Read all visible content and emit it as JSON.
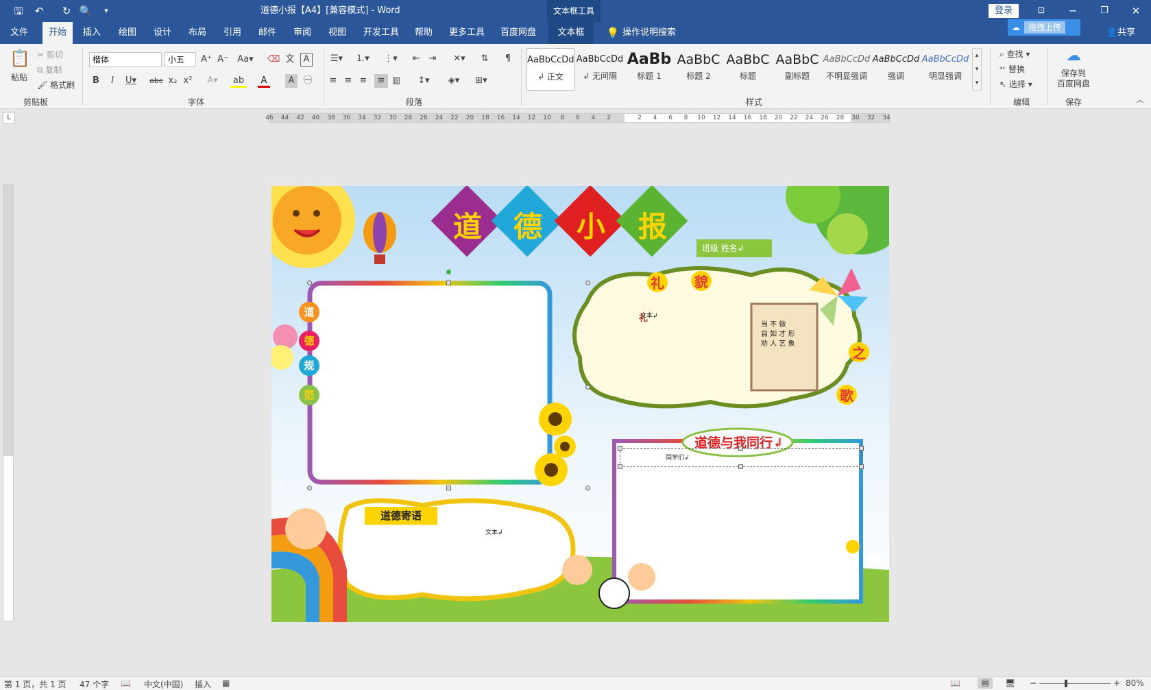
{
  "title_bar": {
    "doc_title": "道德小报【A4】[兼容模式] - Word",
    "context_tool": "文本框工具",
    "login_label": "登录",
    "upload_label": "拖拽上传",
    "share_label": "共享"
  },
  "tabs": [
    "文件",
    "开始",
    "插入",
    "绘图",
    "设计",
    "布局",
    "引用",
    "邮件",
    "审阅",
    "视图",
    "开发工具",
    "帮助",
    "更多工具",
    "百度网盘",
    "文本框"
  ],
  "active_tab": "开始",
  "search_hint": "操作说明搜索",
  "clipboard": {
    "paste": "粘贴",
    "cut": "剪切",
    "copy": "复制",
    "format_painter": "格式刷",
    "group": "剪贴板"
  },
  "font": {
    "name": "楷体",
    "size": "小五",
    "group": "字体"
  },
  "paragraph": {
    "group": "段落"
  },
  "styles": {
    "group": "样式",
    "items": [
      {
        "sample": "AaBbCcDd",
        "name": "↲ 正文"
      },
      {
        "sample": "AaBbCcDd",
        "name": "↲ 无间隔"
      },
      {
        "sample": "AaBb",
        "name": "标题 1"
      },
      {
        "sample": "AaBbC",
        "name": "标题 2"
      },
      {
        "sample": "AaBbC",
        "name": "标题"
      },
      {
        "sample": "AaBbC",
        "name": "副标题"
      },
      {
        "sample": "AaBbCcDd",
        "name": "不明显强调"
      },
      {
        "sample": "AaBbCcDd",
        "name": "强调"
      },
      {
        "sample": "AaBbCcDd",
        "name": "明显强调"
      }
    ]
  },
  "editing": {
    "find": "查找",
    "replace": "替换",
    "select": "选择",
    "group": "编辑"
  },
  "save_group": {
    "save_to": "保存到\n百度网盘",
    "group": "保存"
  },
  "ruler_numbers": [
    "46",
    "44",
    "42",
    "40",
    "38",
    "36",
    "34",
    "32",
    "30",
    "28",
    "26",
    "24",
    "22",
    "20",
    "18",
    "16",
    "14",
    "12",
    "10",
    "8",
    "6",
    "4",
    "2",
    "",
    "2",
    "4",
    "6",
    "8",
    "10",
    "12",
    "14",
    "16",
    "18",
    "20",
    "22",
    "24",
    "26",
    "28",
    "30",
    "32",
    "34"
  ],
  "page": {
    "title_chars": [
      "道",
      "德",
      "小",
      "报"
    ],
    "class_name_label": "班级    姓名↲",
    "side_chars": [
      "道",
      "德",
      "规",
      "范"
    ],
    "poem_title_chars": [
      "礼",
      "貌",
      "之",
      "歌"
    ],
    "text_placeholder": "文本↲",
    "section_title": "道德与我同行↲",
    "section_body": "同学们↲",
    "sayings_title": "道德寄语",
    "sayings_body": "文本↲",
    "poem_text": "当 不 做\n自 如 才 形\n劝 人 艺 象"
  },
  "status": {
    "page": "第 1 页，共 1 页",
    "words": "47 个字",
    "lang": "中文(中国)",
    "mode": "插入",
    "zoom": "80%"
  },
  "colors": {
    "accent": "#2b579a"
  }
}
